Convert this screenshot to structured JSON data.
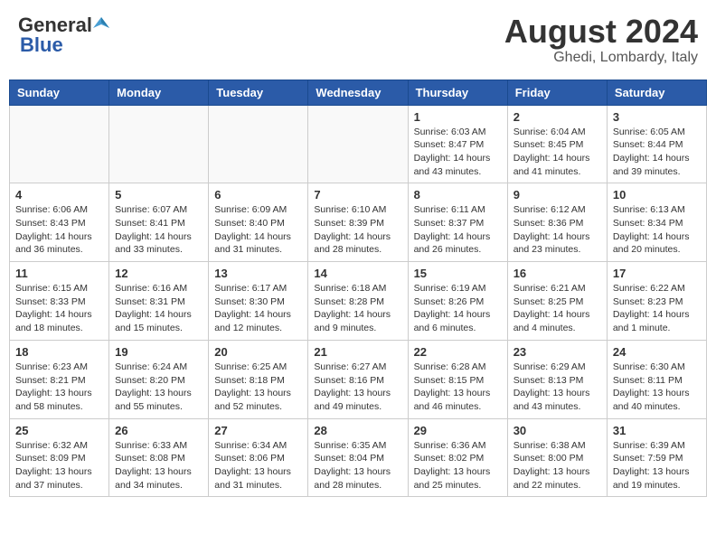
{
  "header": {
    "logo_general": "General",
    "logo_blue": "Blue",
    "month_title": "August 2024",
    "location": "Ghedi, Lombardy, Italy"
  },
  "days_of_week": [
    "Sunday",
    "Monday",
    "Tuesday",
    "Wednesday",
    "Thursday",
    "Friday",
    "Saturday"
  ],
  "weeks": [
    [
      {
        "day": "",
        "info": ""
      },
      {
        "day": "",
        "info": ""
      },
      {
        "day": "",
        "info": ""
      },
      {
        "day": "",
        "info": ""
      },
      {
        "day": "1",
        "info": "Sunrise: 6:03 AM\nSunset: 8:47 PM\nDaylight: 14 hours\nand 43 minutes."
      },
      {
        "day": "2",
        "info": "Sunrise: 6:04 AM\nSunset: 8:45 PM\nDaylight: 14 hours\nand 41 minutes."
      },
      {
        "day": "3",
        "info": "Sunrise: 6:05 AM\nSunset: 8:44 PM\nDaylight: 14 hours\nand 39 minutes."
      }
    ],
    [
      {
        "day": "4",
        "info": "Sunrise: 6:06 AM\nSunset: 8:43 PM\nDaylight: 14 hours\nand 36 minutes."
      },
      {
        "day": "5",
        "info": "Sunrise: 6:07 AM\nSunset: 8:41 PM\nDaylight: 14 hours\nand 33 minutes."
      },
      {
        "day": "6",
        "info": "Sunrise: 6:09 AM\nSunset: 8:40 PM\nDaylight: 14 hours\nand 31 minutes."
      },
      {
        "day": "7",
        "info": "Sunrise: 6:10 AM\nSunset: 8:39 PM\nDaylight: 14 hours\nand 28 minutes."
      },
      {
        "day": "8",
        "info": "Sunrise: 6:11 AM\nSunset: 8:37 PM\nDaylight: 14 hours\nand 26 minutes."
      },
      {
        "day": "9",
        "info": "Sunrise: 6:12 AM\nSunset: 8:36 PM\nDaylight: 14 hours\nand 23 minutes."
      },
      {
        "day": "10",
        "info": "Sunrise: 6:13 AM\nSunset: 8:34 PM\nDaylight: 14 hours\nand 20 minutes."
      }
    ],
    [
      {
        "day": "11",
        "info": "Sunrise: 6:15 AM\nSunset: 8:33 PM\nDaylight: 14 hours\nand 18 minutes."
      },
      {
        "day": "12",
        "info": "Sunrise: 6:16 AM\nSunset: 8:31 PM\nDaylight: 14 hours\nand 15 minutes."
      },
      {
        "day": "13",
        "info": "Sunrise: 6:17 AM\nSunset: 8:30 PM\nDaylight: 14 hours\nand 12 minutes."
      },
      {
        "day": "14",
        "info": "Sunrise: 6:18 AM\nSunset: 8:28 PM\nDaylight: 14 hours\nand 9 minutes."
      },
      {
        "day": "15",
        "info": "Sunrise: 6:19 AM\nSunset: 8:26 PM\nDaylight: 14 hours\nand 6 minutes."
      },
      {
        "day": "16",
        "info": "Sunrise: 6:21 AM\nSunset: 8:25 PM\nDaylight: 14 hours\nand 4 minutes."
      },
      {
        "day": "17",
        "info": "Sunrise: 6:22 AM\nSunset: 8:23 PM\nDaylight: 14 hours\nand 1 minute."
      }
    ],
    [
      {
        "day": "18",
        "info": "Sunrise: 6:23 AM\nSunset: 8:21 PM\nDaylight: 13 hours\nand 58 minutes."
      },
      {
        "day": "19",
        "info": "Sunrise: 6:24 AM\nSunset: 8:20 PM\nDaylight: 13 hours\nand 55 minutes."
      },
      {
        "day": "20",
        "info": "Sunrise: 6:25 AM\nSunset: 8:18 PM\nDaylight: 13 hours\nand 52 minutes."
      },
      {
        "day": "21",
        "info": "Sunrise: 6:27 AM\nSunset: 8:16 PM\nDaylight: 13 hours\nand 49 minutes."
      },
      {
        "day": "22",
        "info": "Sunrise: 6:28 AM\nSunset: 8:15 PM\nDaylight: 13 hours\nand 46 minutes."
      },
      {
        "day": "23",
        "info": "Sunrise: 6:29 AM\nSunset: 8:13 PM\nDaylight: 13 hours\nand 43 minutes."
      },
      {
        "day": "24",
        "info": "Sunrise: 6:30 AM\nSunset: 8:11 PM\nDaylight: 13 hours\nand 40 minutes."
      }
    ],
    [
      {
        "day": "25",
        "info": "Sunrise: 6:32 AM\nSunset: 8:09 PM\nDaylight: 13 hours\nand 37 minutes."
      },
      {
        "day": "26",
        "info": "Sunrise: 6:33 AM\nSunset: 8:08 PM\nDaylight: 13 hours\nand 34 minutes."
      },
      {
        "day": "27",
        "info": "Sunrise: 6:34 AM\nSunset: 8:06 PM\nDaylight: 13 hours\nand 31 minutes."
      },
      {
        "day": "28",
        "info": "Sunrise: 6:35 AM\nSunset: 8:04 PM\nDaylight: 13 hours\nand 28 minutes."
      },
      {
        "day": "29",
        "info": "Sunrise: 6:36 AM\nSunset: 8:02 PM\nDaylight: 13 hours\nand 25 minutes."
      },
      {
        "day": "30",
        "info": "Sunrise: 6:38 AM\nSunset: 8:00 PM\nDaylight: 13 hours\nand 22 minutes."
      },
      {
        "day": "31",
        "info": "Sunrise: 6:39 AM\nSunset: 7:59 PM\nDaylight: 13 hours\nand 19 minutes."
      }
    ]
  ]
}
